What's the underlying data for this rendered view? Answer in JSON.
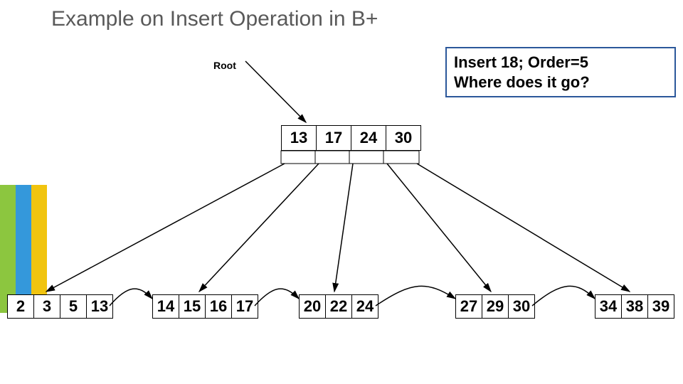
{
  "title": "Example on Insert Operation in B+",
  "root_label": "Root",
  "callout_line1": "Insert 18; Order=5",
  "callout_line2": "Where does it go?",
  "root_keys": [
    "13",
    "17",
    "24",
    "30"
  ],
  "leaves": [
    [
      "2",
      "3",
      "5",
      "13"
    ],
    [
      "14",
      "15",
      "16",
      "17"
    ],
    [
      "20",
      "22",
      "24"
    ],
    [
      "27",
      "29",
      "30"
    ],
    [
      "34",
      "38",
      "39"
    ]
  ]
}
